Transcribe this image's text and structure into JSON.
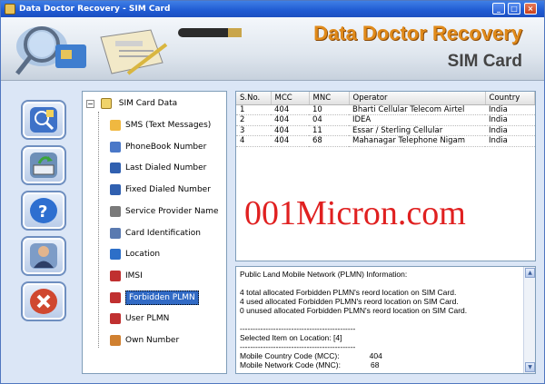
{
  "window": {
    "title": "Data Doctor Recovery - SIM Card"
  },
  "banner": {
    "brand": "Data Doctor Recovery",
    "product": "SIM Card"
  },
  "sidebar": [
    {
      "name": "search-sim-button-icon"
    },
    {
      "name": "save-button-icon"
    },
    {
      "name": "help-button-icon"
    },
    {
      "name": "about-button-icon"
    },
    {
      "name": "exit-button-icon"
    }
  ],
  "tree": {
    "root": "SIM Card Data",
    "items": [
      {
        "label": "SMS (Text Messages)",
        "icon": "sms-icon"
      },
      {
        "label": "PhoneBook Number",
        "icon": "phonebook-icon"
      },
      {
        "label": "Last Dialed Number",
        "icon": "last-dialed-icon"
      },
      {
        "label": "Fixed Dialed Number",
        "icon": "fixed-dialed-icon"
      },
      {
        "label": "Service Provider Name",
        "icon": "service-provider-icon"
      },
      {
        "label": "Card Identification",
        "icon": "card-id-icon"
      },
      {
        "label": "Location",
        "icon": "location-icon"
      },
      {
        "label": "IMSI",
        "icon": "imsi-icon"
      },
      {
        "label": "Forbidden PLMN",
        "icon": "forbidden-plmn-icon",
        "selected": true
      },
      {
        "label": "User PLMN",
        "icon": "user-plmn-icon"
      },
      {
        "label": "Own Number",
        "icon": "own-number-icon"
      }
    ]
  },
  "table": {
    "headers": [
      "S.No.",
      "MCC",
      "MNC",
      "Operator",
      "Country"
    ],
    "rows": [
      [
        "1",
        "404",
        "10",
        "Bharti Cellular Telecom Airtel",
        "India"
      ],
      [
        "2",
        "404",
        "04",
        "IDEA",
        "India"
      ],
      [
        "3",
        "404",
        "11",
        "Essar / Sterling Cellular",
        "India"
      ],
      [
        "4",
        "404",
        "68",
        "Mahanagar Telephone Nigam",
        "India"
      ]
    ]
  },
  "watermark": "001Micron.com",
  "info": {
    "text": "Public Land Mobile Network (PLMN) Information:\n\n4 total allocated Forbidden PLMN's reord location on SIM Card.\n4 used allocated Forbidden PLMN's reord location on SIM Card.\n0 unused allocated Forbidden PLMN's reord location on SIM Card.\n\n---------------------------------------------\nSelected Item on Location: [4]\n---------------------------------------------\nMobile Country Code (MCC):              404\nMobile Network Code (MNC):              68"
  }
}
